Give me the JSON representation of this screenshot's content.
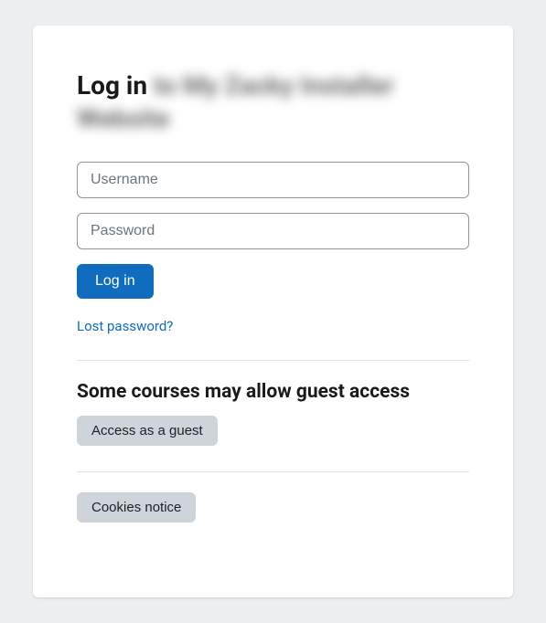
{
  "heading": {
    "prefix": "Log in",
    "blurred": "to My Zacky Installer Website"
  },
  "form": {
    "username_placeholder": "Username",
    "password_placeholder": "Password",
    "login_button": "Log in",
    "lost_password": "Lost password?"
  },
  "guest": {
    "heading": "Some courses may allow guest access",
    "button": "Access as a guest"
  },
  "footer": {
    "cookies_button": "Cookies notice"
  }
}
